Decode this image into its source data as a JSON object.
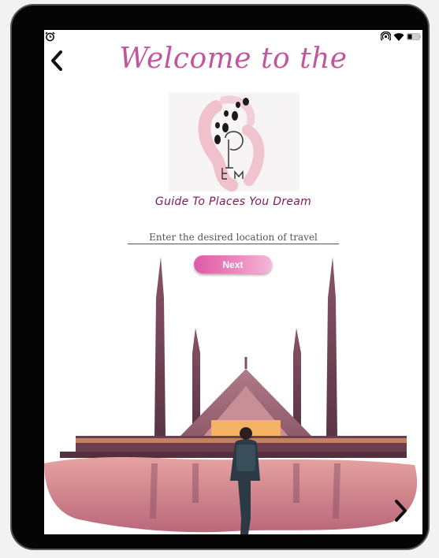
{
  "status_bar": {
    "alarm_icon": "alarm-clock-icon",
    "icons": [
      "hotspot-icon",
      "wifi-icon",
      "battery-icon"
    ]
  },
  "nav": {
    "back_icon": "chevron-left-icon",
    "forward_icon": "chevron-right-icon"
  },
  "header": {
    "welcome": "Welcome to the"
  },
  "logo": {
    "icon": "footsteps-logo-icon"
  },
  "tagline": "Guide To Places You Dream",
  "search": {
    "placeholder": "Enter the desired location of travel",
    "value": ""
  },
  "next_button": {
    "label": "Next"
  },
  "colors": {
    "accent": "#c2569d",
    "tagline": "#7d1858",
    "button_start": "#de5aa7",
    "button_end": "#f5b8d6"
  },
  "illustration": {
    "icon": "mosque-traveler-illustration"
  }
}
